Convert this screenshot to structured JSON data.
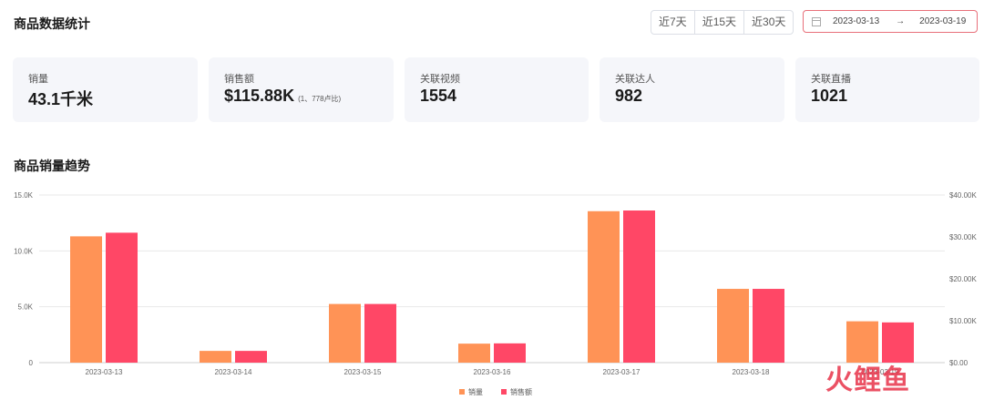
{
  "header": {
    "title": "商品数据统计",
    "ranges": [
      "近7天",
      "近15天",
      "近30天"
    ],
    "date_start": "2023-03-13",
    "date_sep": "→",
    "date_end": "2023-03-19"
  },
  "cards": [
    {
      "label": "销量",
      "value": "43.1千米",
      "note": ""
    },
    {
      "label": "销售额",
      "value": "$115.88K",
      "note": "(1、778卢比)"
    },
    {
      "label": "关联视频",
      "value": "1554",
      "note": ""
    },
    {
      "label": "关联达人",
      "value": "982",
      "note": ""
    },
    {
      "label": "关联直播",
      "value": "1021",
      "note": ""
    }
  ],
  "chart_title": "商品销量趋势",
  "watermark": "火鲤鱼",
  "colors": {
    "sales": "#ff9356",
    "amount": "#ff4766",
    "grid": "#e8e8e8"
  },
  "chart_data": {
    "type": "bar",
    "categories": [
      "2023-03-13",
      "2023-03-14",
      "2023-03-15",
      "2023-03-16",
      "2023-03-17",
      "2023-03-18",
      "2023-03-19"
    ],
    "series": [
      {
        "name": "销量",
        "axis": "left",
        "values": [
          11300,
          1050,
          5250,
          1700,
          13550,
          6600,
          3700
        ]
      },
      {
        "name": "销售额",
        "axis": "right",
        "values": [
          31000,
          2800,
          14000,
          4600,
          36300,
          17600,
          9600
        ]
      }
    ],
    "y_left": {
      "ylim": [
        0,
        15000
      ],
      "ticks": [
        0,
        5000,
        10000,
        15000
      ],
      "tick_labels": [
        "0",
        "5.0K",
        "10.0K",
        "15.0K"
      ]
    },
    "y_right": {
      "ylim": [
        0,
        40000
      ],
      "ticks": [
        0,
        10000,
        20000,
        30000,
        40000
      ],
      "tick_labels": [
        "$0.00",
        "$10.00K",
        "$20.00K",
        "$30.00K",
        "$40.00K"
      ]
    },
    "legend": "bottom-center",
    "grid": true
  }
}
